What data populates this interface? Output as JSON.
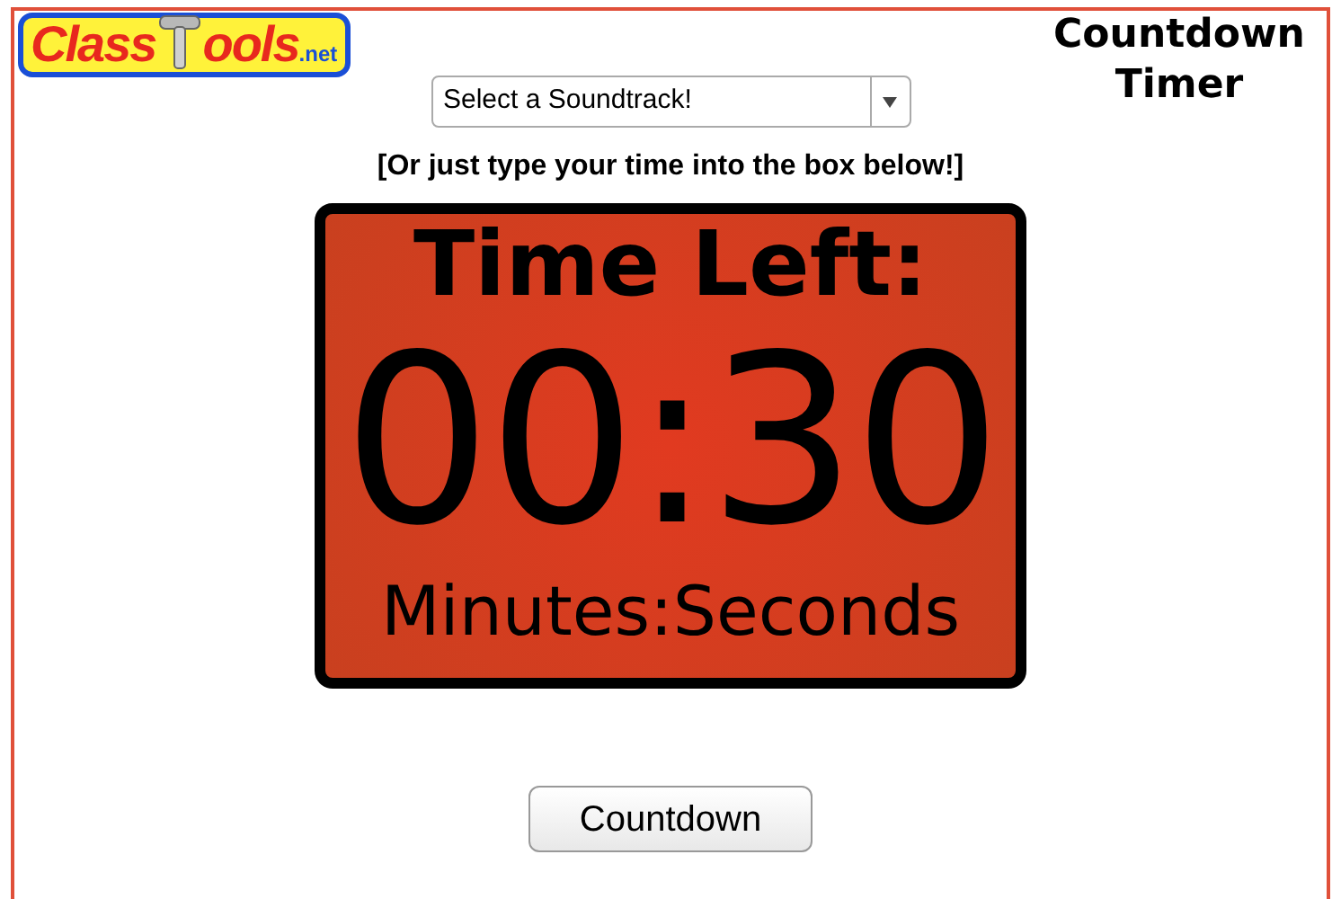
{
  "logo": {
    "parts": [
      "Class",
      "ools",
      ".net"
    ]
  },
  "title": "Countdown Timer",
  "soundtrack_select": {
    "value": "Select a Soundtrack!"
  },
  "instruction": "[Or just type your time into the box below!]",
  "timer": {
    "heading": "Time Left:",
    "time": "00:30",
    "units": "Minutes:Seconds"
  },
  "buttons": [
    "Countdown"
  ]
}
